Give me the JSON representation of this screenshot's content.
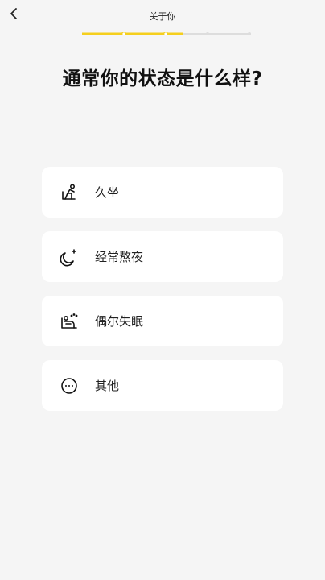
{
  "header": {
    "title": "关于你",
    "progress": 0.6,
    "steps_total": 5,
    "steps_done": 3
  },
  "question": "通常你的状态是什么样?",
  "options": [
    {
      "label": "久坐",
      "icon": "sitting-person-icon"
    },
    {
      "label": "经常熬夜",
      "icon": "moon-star-icon"
    },
    {
      "label": "偶尔失眠",
      "icon": "sleepless-person-icon"
    },
    {
      "label": "其他",
      "icon": "more-dots-icon"
    }
  ],
  "colors": {
    "accent": "#f5cf1d",
    "track": "#dddddd",
    "background": "#f5f5f5",
    "card": "#ffffff"
  }
}
